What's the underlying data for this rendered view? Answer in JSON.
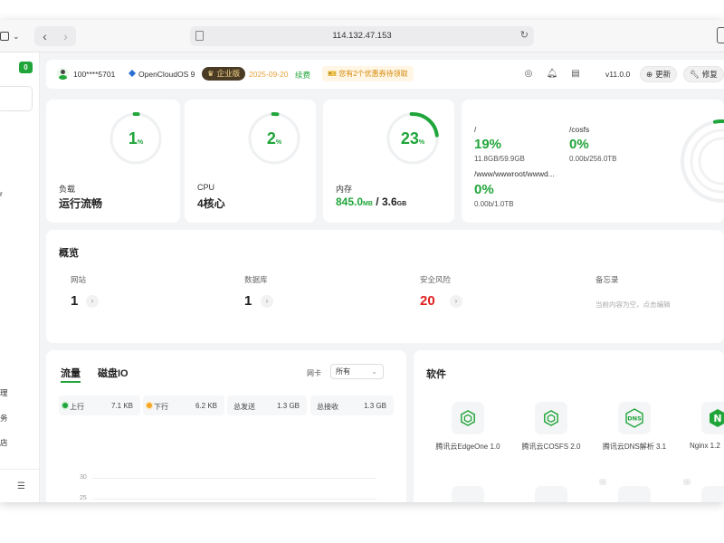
{
  "browser": {
    "url": "114.132.47.153"
  },
  "sidebar": {
    "badge": "0",
    "fragments": [
      "r",
      "理",
      "务",
      "店"
    ]
  },
  "header": {
    "user": "100****5701",
    "os": "OpenCloudOS 9",
    "edition": "企业版",
    "expire_date": "2025-09-20",
    "renew": "续费",
    "coupon": "您有2个优惠券待领取",
    "version": "v11.0.0",
    "update_btn": "更新",
    "repair_btn": "修复"
  },
  "stats": {
    "load": {
      "percent": 1,
      "label": "负载",
      "value": "运行流畅"
    },
    "cpu": {
      "percent": 2,
      "label": "CPU",
      "value": "4核心"
    },
    "memory": {
      "percent": 23,
      "label": "内存",
      "used": "845.0",
      "used_unit": "MB",
      "sep": " / ",
      "total": "3.6",
      "total_unit": "GB"
    }
  },
  "disks": [
    {
      "name": "/",
      "percent": "19%",
      "size": "11.8GB/59.9GB"
    },
    {
      "name": "/cosfs",
      "percent": "0%",
      "size": "0.00b/256.0TB"
    },
    {
      "name": "/www/wwwroot/wwwd...",
      "percent": "0%",
      "size": "0.00b/1.0TB"
    }
  ],
  "overview": {
    "title": "概览",
    "sites": {
      "label": "网站",
      "value": "1"
    },
    "databases": {
      "label": "数据库",
      "value": "1"
    },
    "risks": {
      "label": "安全风险",
      "value": "20"
    },
    "memo": {
      "label": "备忘录",
      "note": "当前内容为空，点击编辑"
    }
  },
  "traffic": {
    "tab_traffic": "流量",
    "tab_diskio": "磁盘IO",
    "nic_label": "网卡",
    "nic_value": "所有",
    "up": {
      "label": "上行",
      "value": "7.1 KB"
    },
    "down": {
      "label": "下行",
      "value": "6.2 KB"
    },
    "total_sent": {
      "label": "总发送",
      "value": "1.3 GB"
    },
    "total_recv": {
      "label": "总接收",
      "value": "1.3 GB"
    },
    "y_ticks": [
      "30",
      "25"
    ]
  },
  "software": {
    "title": "软件",
    "items": [
      {
        "name": "腾讯云EdgeOne 1.0"
      },
      {
        "name": "腾讯云COSFS 2.0"
      },
      {
        "name": "腾讯云DNS解析 3.1",
        "icon_text": "DNS"
      },
      {
        "name": "Nginx 1.2",
        "icon_text": "N"
      }
    ]
  },
  "colors": {
    "accent": "#20a53a",
    "danger": "#e02020",
    "warning": "#e6a23c",
    "enterprise_bg": "#4a3b24"
  }
}
